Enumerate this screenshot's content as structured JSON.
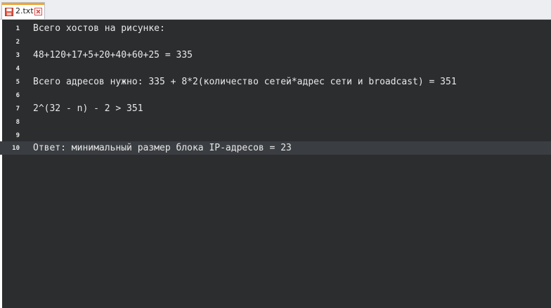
{
  "tab": {
    "label": "2.txt"
  },
  "colors": {
    "background": "#2b2d2f",
    "text": "#e8e8e8",
    "current_line": "#3a3d41",
    "tab_accent": "#f0a22e",
    "close_icon": "#d9534f"
  },
  "editor": {
    "current_line": 10,
    "lines": [
      {
        "number": "1",
        "text": "Всего хостов на рисунке:"
      },
      {
        "number": "2",
        "text": ""
      },
      {
        "number": "3",
        "text": "48+120+17+5+20+40+60+25 = 335"
      },
      {
        "number": "4",
        "text": ""
      },
      {
        "number": "5",
        "text": "Всего адресов нужно: 335 + 8*2(количество сетей*адрес сети и broadcast) = 351"
      },
      {
        "number": "6",
        "text": ""
      },
      {
        "number": "7",
        "text": "2^(32 - n) - 2 > 351"
      },
      {
        "number": "8",
        "text": ""
      },
      {
        "number": "9",
        "text": ""
      },
      {
        "number": "10",
        "text": "Ответ: минимальный размер блока IP-адресов = 23"
      }
    ]
  }
}
